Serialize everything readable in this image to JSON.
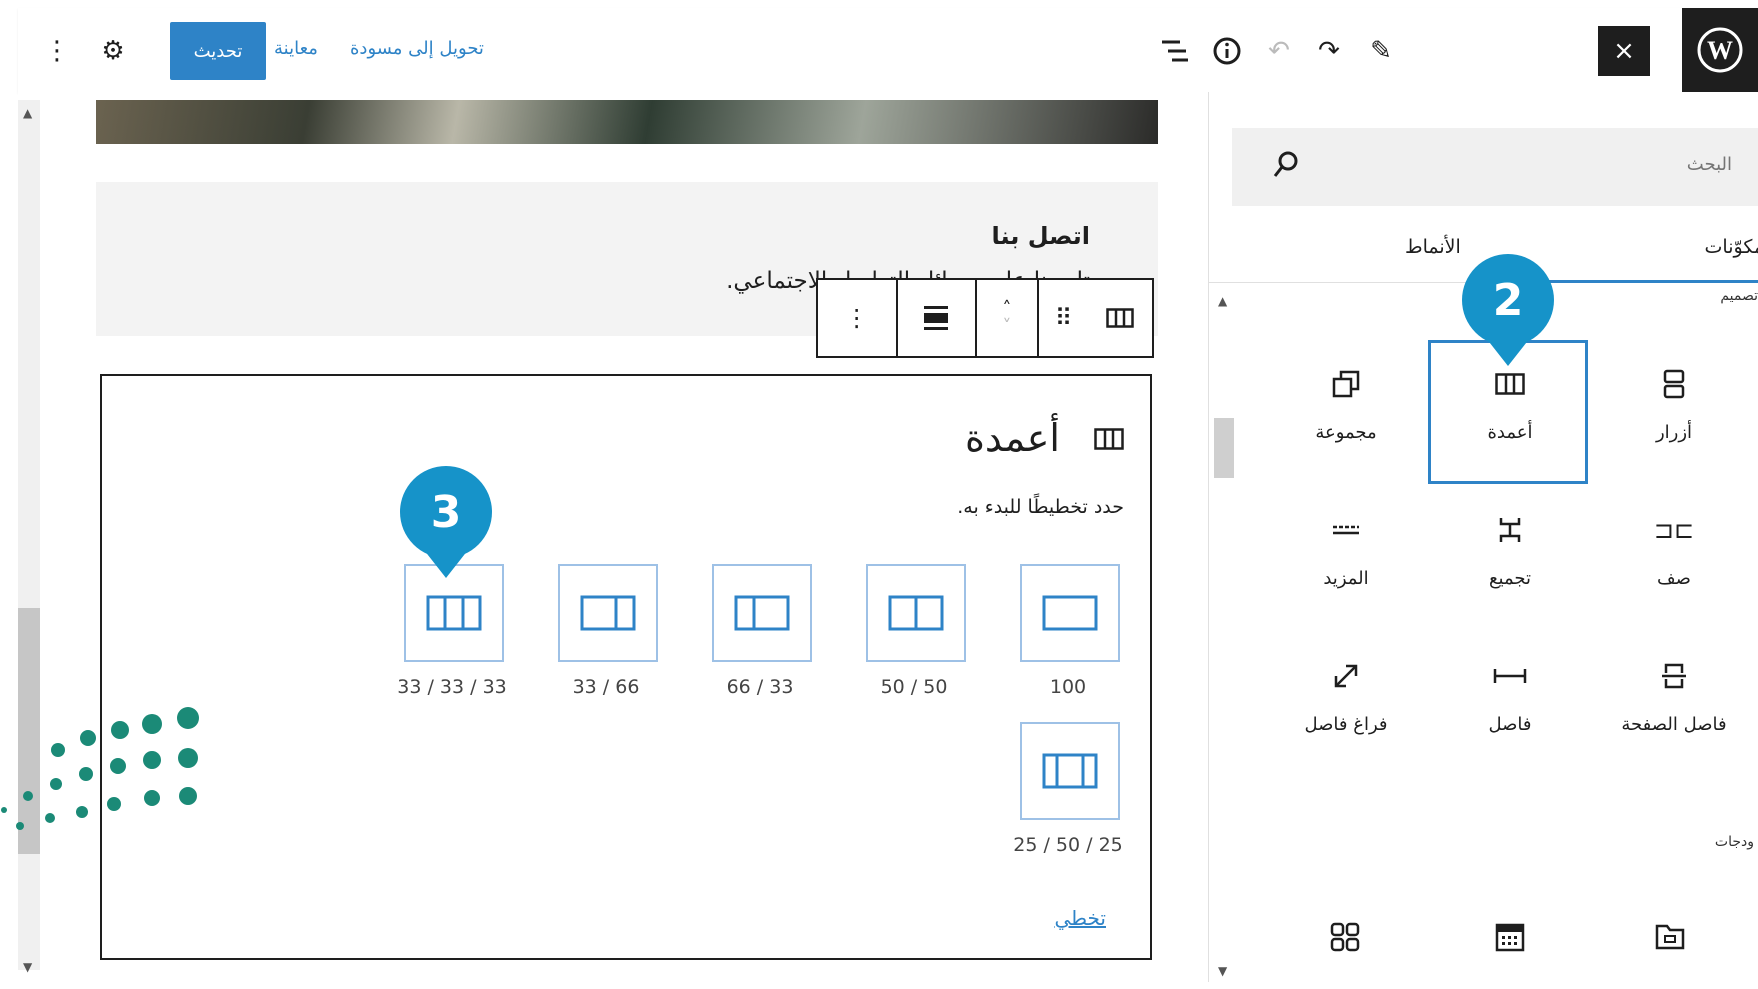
{
  "topbar": {
    "update_label": "تحديث",
    "preview_label": "معاينة",
    "switch_to_draft_label": "تحويل إلى مسودة",
    "close_symbol": "×",
    "icons": [
      "more-vertical-icon",
      "gear-icon",
      "list-view-icon",
      "info-icon",
      "undo-icon",
      "redo-icon",
      "pencil-icon",
      "close-icon",
      "wordpress-logo-icon"
    ]
  },
  "canvas": {
    "contact_title": "اتصل بنا",
    "contact_body": "تابعونا على وسائل التواصل الاجتماعي."
  },
  "columns_block": {
    "title": "أعمدة",
    "instruction": "حدد تخطيطًا للبدء به.",
    "variations": [
      "100",
      "50 / 50",
      "66 / 33",
      "33 / 66",
      "33 / 33 / 33",
      "25 / 50 / 25"
    ],
    "skip_label": "تخطي"
  },
  "sidebar": {
    "search_placeholder": "البحث",
    "tabs": {
      "blocks": "مكوّنات",
      "patterns": "الأنماط"
    },
    "design_heading": "تصميم",
    "widgets_heading": "ودجات",
    "blocks": [
      {
        "label": "أزرار",
        "icon": "buttons-icon"
      },
      {
        "label": "أعمدة",
        "icon": "columns-icon"
      },
      {
        "label": "مجموعة",
        "icon": "group-icon"
      },
      {
        "label": "صف",
        "icon": "row-icon"
      },
      {
        "label": "تجميع",
        "icon": "stack-icon"
      },
      {
        "label": "المزيد",
        "icon": "more-icon"
      },
      {
        "label": "فاصل الصفحة",
        "icon": "page-break-icon"
      },
      {
        "label": "فاصل",
        "icon": "separator-icon"
      },
      {
        "label": "فراغ فاصل",
        "icon": "spacer-icon"
      }
    ]
  },
  "markers": {
    "sidebar_marker": "2",
    "canvas_marker": "3"
  },
  "colors": {
    "accent": "#2e83c7",
    "marker": "#1693c9",
    "dark": "#1e1e1e",
    "selection": "#2e83c7"
  }
}
